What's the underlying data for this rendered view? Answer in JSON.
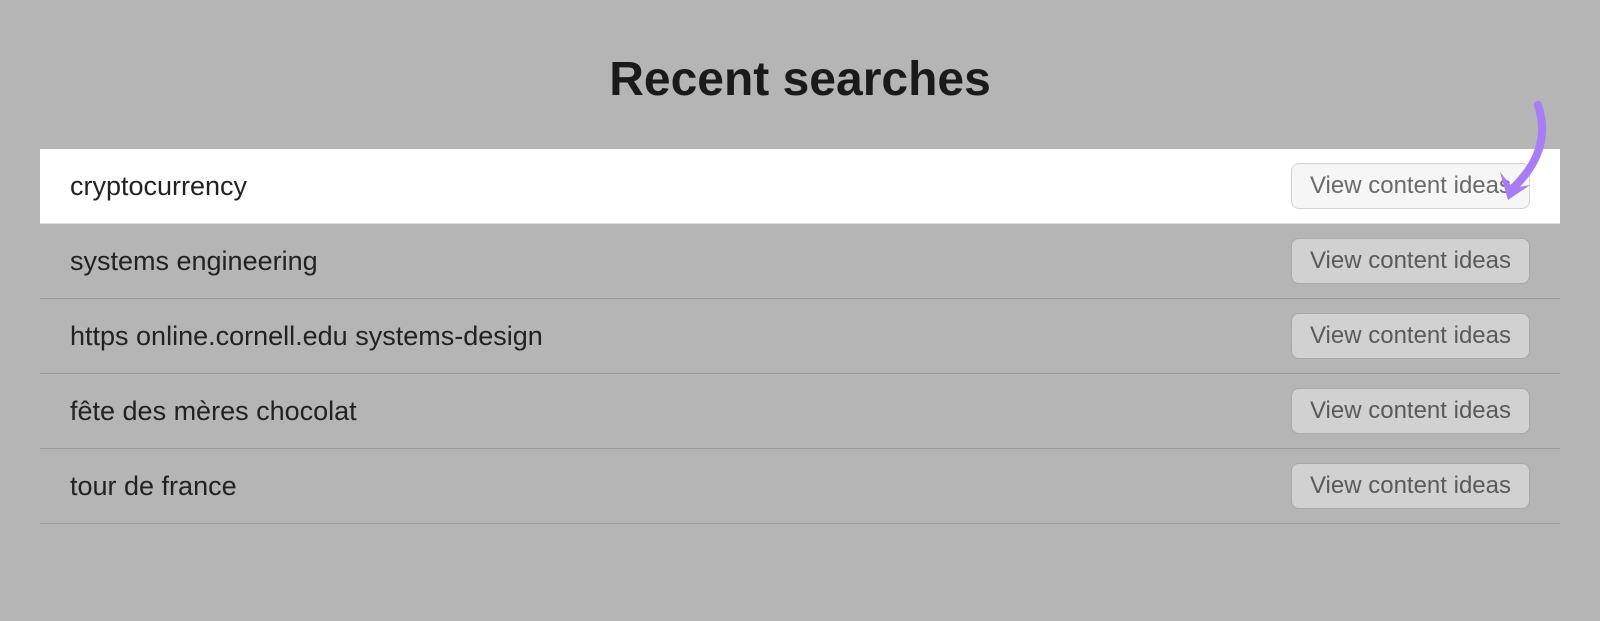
{
  "header": {
    "title": "Recent searches"
  },
  "searches": [
    {
      "term": "cryptocurrency",
      "button_label": "View content ideas",
      "highlighted": true
    },
    {
      "term": "systems engineering",
      "button_label": "View content ideas",
      "highlighted": false
    },
    {
      "term": "https online.cornell.edu systems-design",
      "button_label": "View content ideas",
      "highlighted": false
    },
    {
      "term": "fête des mères chocolat",
      "button_label": "View content ideas",
      "highlighted": false
    },
    {
      "term": "tour de france",
      "button_label": "View content ideas",
      "highlighted": false
    }
  ],
  "annotation": {
    "color": "#a77cf4"
  }
}
